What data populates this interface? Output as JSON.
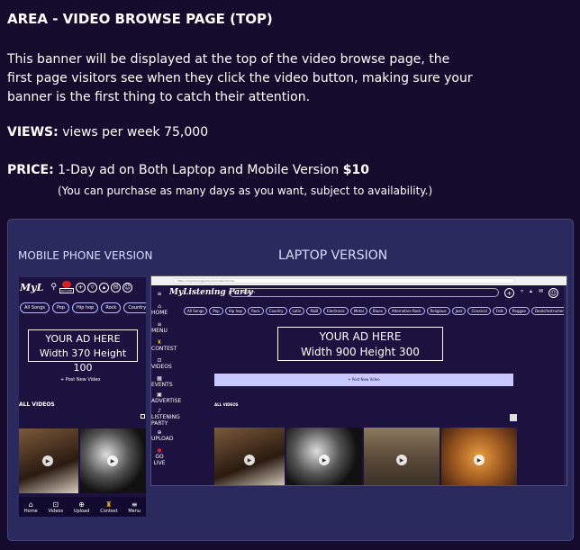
{
  "heading": "AREA - VIDEO BROWSE PAGE (TOP)",
  "description": "This banner will be displayed at the top of the video browse page, the first page visitors see when they click the video button, making sure your banner is the first thing to catch their attention.",
  "views": {
    "label": "VIEWS:",
    "text": "views per week 75,000"
  },
  "price": {
    "label": "PRICE:",
    "text": "1-Day ad on Both Laptop and Mobile Version",
    "amount": "$10",
    "note": "(You can purchase as many days as you want, subject to availability.)"
  },
  "mobile": {
    "title": "MOBILE PHONE VERSION",
    "logo": "MyL",
    "live_label": "GO LIVE",
    "chips": [
      "All Songs",
      "Pop",
      "Hip hop",
      "Rock",
      "Country"
    ],
    "ad_line1": "YOUR AD HERE",
    "ad_line2": "Width 370 Height 100",
    "post_label": "+ Post New Video",
    "all_videos": "ALL VIDEOS",
    "nav": [
      "Home",
      "Videos",
      "Upload",
      "Contest",
      "Menu"
    ]
  },
  "laptop": {
    "title": "LAPTOP VERSION",
    "url": "https://mylisteningparty.com/videos/home",
    "logo": "MyListening Party",
    "search_placeholder": "Search",
    "chips": [
      "All Songs",
      "Pop",
      "Hip hop",
      "Rock",
      "Country",
      "Latin",
      "R&B",
      "Electronic",
      "Metal",
      "Blues",
      "Alternative Rock",
      "Religious",
      "Jazz",
      "Classical",
      "Folk",
      "Reggae",
      "Deals/Instrumental"
    ],
    "sidebar": [
      "HOME",
      "MENU",
      "CONTEST",
      "VIDEOS",
      "EVENTS",
      "ADVERTISE",
      "LISTENING PARTY",
      "UPLOAD",
      "GO LIVE"
    ],
    "ad_line1": "YOUR AD HERE",
    "ad_line2": "Width 900 Height 300",
    "post_label": "+ Post New Video",
    "all_videos": "ALL VIDEOS"
  }
}
